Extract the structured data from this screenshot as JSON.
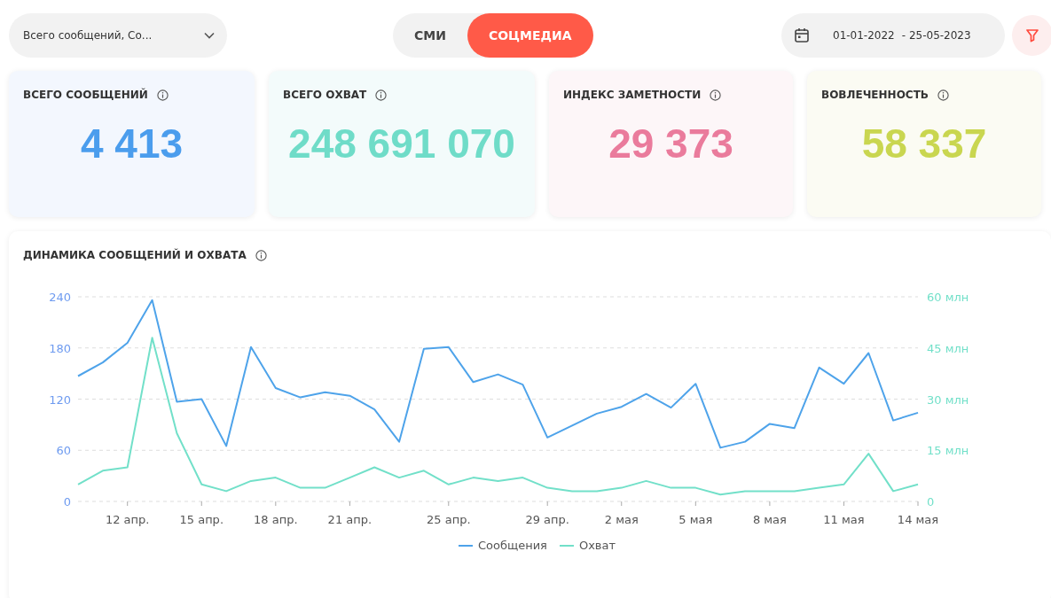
{
  "toolbar": {
    "metric_select": {
      "value": "Всего сообщений, Со..."
    },
    "source_tabs": [
      {
        "label": "СМИ",
        "selected": false
      },
      {
        "label": "СОЦМЕДИА",
        "selected": true
      }
    ],
    "date_range": {
      "start": "01-01-2022",
      "end": "- 25-05-2023"
    }
  },
  "kpis": [
    {
      "title": "ВСЕГО СООБЩЕНИЙ",
      "value": "4 413",
      "color": "#4b9ded"
    },
    {
      "title": "ВСЕГО ОХВАТ",
      "value": "248 691 070",
      "color": "#6fdcc8"
    },
    {
      "title": "ИНДЕКС ЗАМЕТНОСТИ",
      "value": "29 373",
      "color": "#ea7b9c"
    },
    {
      "title": "ВОВЛЕЧЕННОСТЬ",
      "value": "58 337",
      "color": "#c9d650"
    }
  ],
  "dynamics": {
    "title": "ДИНАМИКА СООБЩЕНИЙ И ОХВАТА",
    "chart_data": {
      "type": "line",
      "grid": true,
      "categories": [
        null,
        null,
        "12 апр.",
        null,
        null,
        "15 апр.",
        null,
        null,
        "18 апр.",
        null,
        null,
        "21 апр.",
        null,
        null,
        null,
        "25 апр.",
        null,
        null,
        null,
        "29 апр.",
        null,
        null,
        "2 мая",
        null,
        null,
        "5 мая",
        null,
        null,
        "8 мая",
        null,
        null,
        "11 мая",
        null,
        null,
        "14 мая"
      ],
      "ylim": [
        0,
        240
      ],
      "yticks": [
        0,
        60,
        120,
        180,
        240
      ],
      "y2lim": [
        0,
        60
      ],
      "y2ticks": [
        {
          "value": 0,
          "label": "0"
        },
        {
          "value": 15,
          "label": "15 млн"
        },
        {
          "value": 30,
          "label": "30 млн"
        },
        {
          "value": 45,
          "label": "45 млн"
        },
        {
          "value": 60,
          "label": "60 млн"
        }
      ],
      "series": [
        {
          "name": "Сообщения",
          "color": "#4ea3ea",
          "values": [
            147,
            163,
            186,
            236,
            117,
            120,
            65,
            181,
            133,
            122,
            128,
            124,
            108,
            70,
            179,
            181,
            140,
            149,
            137,
            75,
            89,
            103,
            111,
            126,
            110,
            138,
            63,
            70,
            91,
            86,
            157,
            138,
            174,
            95,
            104
          ]
        },
        {
          "name": "Охват",
          "color": "#72e0c9",
          "axis": "y2",
          "values": [
            5,
            9,
            10,
            48,
            20,
            5,
            3,
            6,
            7,
            4,
            4,
            7,
            10,
            7,
            9,
            5,
            7,
            6,
            7,
            4,
            3,
            3,
            4,
            6,
            4,
            4,
            2,
            3,
            3,
            3,
            4,
            5,
            14,
            3,
            5
          ]
        }
      ]
    }
  }
}
